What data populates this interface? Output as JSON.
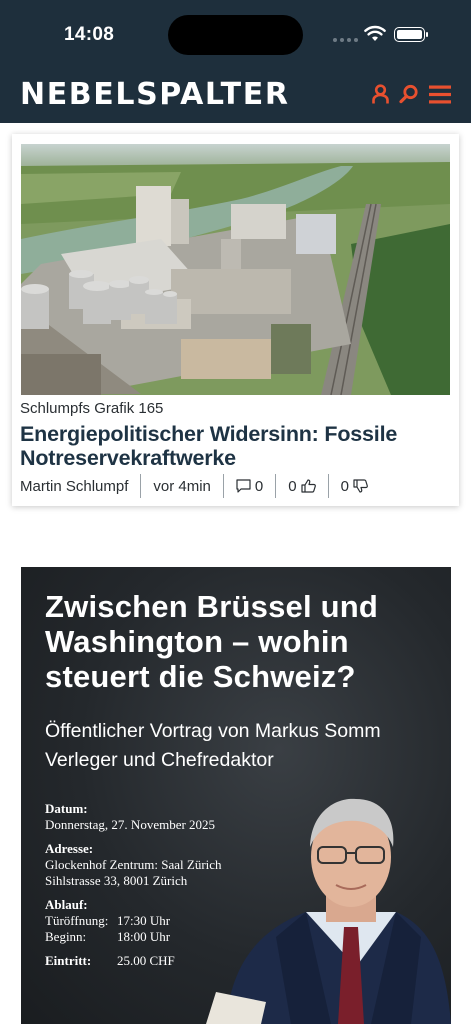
{
  "status_bar": {
    "time": "14:08"
  },
  "header": {
    "logo": "NEBELSPALTER",
    "icons": [
      "user-icon",
      "search-icon",
      "menu-icon"
    ],
    "accent": "#e8502f",
    "background": "#1e2f3c"
  },
  "article": {
    "kicker": "Schlumpfs Grafik 165",
    "title": "Energiepolitischer Widersinn: Fossile Notreservekraftwerke",
    "author": "Martin Schlumpf",
    "time_ago": "vor 4min",
    "comments": "0",
    "likes": "0",
    "dislikes": "0",
    "image": "aerial-industrial-plant-by-river"
  },
  "event": {
    "title": "Zwischen Brüssel und Washington – wohin steuert die Schweiz?",
    "subtitle_1": "Öffentlicher Vortrag von Markus Somm",
    "subtitle_2": "Verleger und Chefredaktor",
    "date_label": "Datum:",
    "date_value": "Donnerstag, 27. November 2025",
    "address_label": "Adresse:",
    "address_line_1": "Glockenhof Zentrum: Saal Zürich",
    "address_line_2": "Sihlstrasse 33, 8001 Zürich",
    "schedule_label": "Ablauf:",
    "doors_label": "Türöffnung:",
    "doors_time": "17:30 Uhr",
    "start_label": "Beginn:",
    "start_time": "18:00 Uhr",
    "entry_label": "Eintritt:",
    "entry_price": "25.00 CHF"
  }
}
